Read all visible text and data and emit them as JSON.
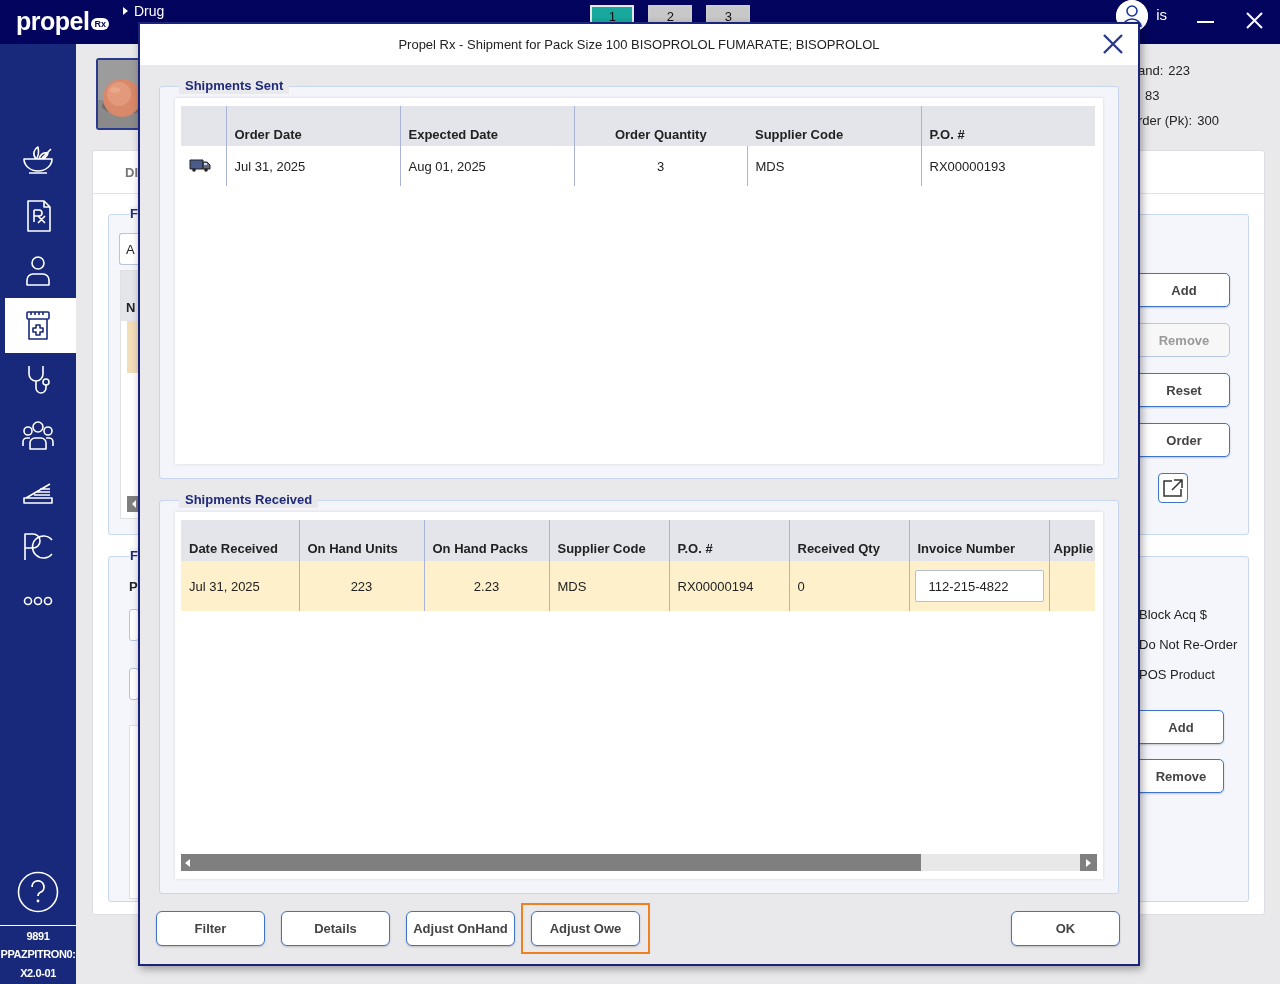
{
  "app_bar": {
    "logo": "propel",
    "logo_badge": "Rx",
    "breadcrumb": "Drug",
    "workspace_tabs": [
      {
        "label": "1",
        "selected": true
      },
      {
        "label": "2",
        "selected": false
      },
      {
        "label": "3",
        "selected": false
      }
    ],
    "user": "is"
  },
  "sidebar": {
    "items": [
      {
        "kind": "mortar",
        "selected": false
      },
      {
        "kind": "document",
        "selected": false
      },
      {
        "kind": "person",
        "selected": false
      },
      {
        "kind": "jar",
        "selected": true
      },
      {
        "kind": "stethoscope",
        "selected": false
      },
      {
        "kind": "people",
        "selected": false
      },
      {
        "kind": "scanner",
        "selected": false
      },
      {
        "kind": "curves",
        "selected": false
      },
      {
        "kind": "more",
        "selected": false
      }
    ],
    "footer": [
      "9891",
      "PPAZPITRON0:",
      "X2.0-01"
    ]
  },
  "drug_screen": {
    "stats": [
      {
        "label": "and:",
        "value": "223"
      },
      {
        "value": "83"
      },
      {
        "label": "rder (Pk):",
        "value": "300"
      }
    ],
    "card_heading": "DI",
    "top_panel": {
      "legend": "F",
      "field": "A",
      "table_header": "N",
      "buttons": [
        {
          "label": "Add",
          "disabled": false
        },
        {
          "label": "Remove",
          "disabled": true
        },
        {
          "label": "Reset",
          "disabled": false
        },
        {
          "label": "Order",
          "disabled": false
        }
      ]
    },
    "bottom_panel": {
      "legend": "F",
      "label": "P",
      "options": [
        "Block Acq $",
        "Do Not Re-Order",
        "POS Product"
      ],
      "buttons": [
        {
          "label": "Add",
          "disabled": false
        },
        {
          "label": "Remove",
          "disabled": false
        }
      ]
    }
  },
  "dialog": {
    "title": "Propel Rx - Shipment for Pack Size 100 BISOPROLOL FUMARATE; BISOPROLOL",
    "shipments_sent": {
      "legend": "Shipments Sent",
      "columns": [
        "Order Date",
        "Expected Date",
        "Order Quantity",
        "Supplier Code",
        "P.O. #"
      ],
      "rows": [
        {
          "cells": [
            "Jul 31, 2025",
            "Aug 01, 2025",
            "3",
            "MDS",
            "RX00000193"
          ]
        }
      ]
    },
    "shipments_received": {
      "legend": "Shipments Received",
      "columns": [
        "Date Received",
        "On Hand Units",
        "On Hand Packs",
        "Supplier Code",
        "P.O. #",
        "Received Qty",
        "Invoice Number",
        "Applie"
      ],
      "rows": [
        {
          "selected": true,
          "cells": [
            "Jul 31, 2025",
            "223",
            "2.23",
            "MDS",
            "RX00000194",
            "0"
          ],
          "invoice_number": "112-215-4822"
        }
      ]
    },
    "buttons": [
      {
        "label": "Filter",
        "highlighted": false
      },
      {
        "label": "Details",
        "highlighted": false
      },
      {
        "label": "Adjust OnHand",
        "highlighted": false
      },
      {
        "label": "Adjust Owe",
        "highlighted": true
      }
    ],
    "ok_button": "OK"
  }
}
